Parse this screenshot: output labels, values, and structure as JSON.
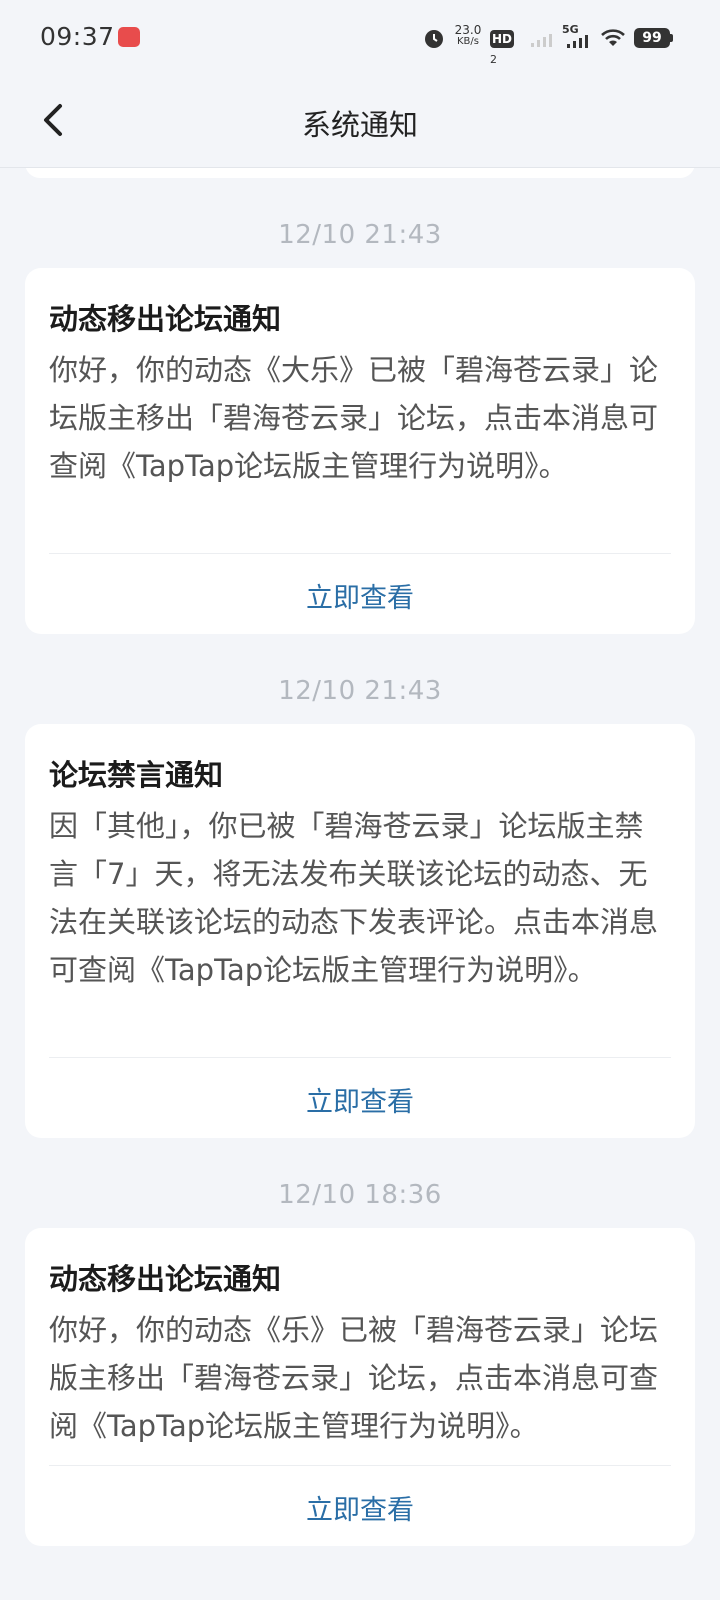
{
  "status_bar": {
    "time": "09:37",
    "net_speed_value": "23.0",
    "net_speed_unit": "KB/s",
    "hd_label": "HD",
    "hd_sub": "2",
    "network": "5G",
    "battery": "99",
    "icons": [
      "app-notification-icon",
      "alarm-icon",
      "hd-icon",
      "signal-weak-icon",
      "signal-5g-icon",
      "wifi-icon",
      "battery-icon"
    ]
  },
  "nav": {
    "back_icon": "chevron-left-icon",
    "title": "系统通知"
  },
  "notifications": [
    {
      "timestamp": "12/10  21:43",
      "title": "动态移出论坛通知",
      "body": "你好，你的动态《大乐》已被「碧海苍云录」论坛版主移出「碧海苍云录」论坛，点击本消息可查阅《TapTap论坛版主管理行为说明》。",
      "action": "立即查看"
    },
    {
      "timestamp": "12/10  21:43",
      "title": "论坛禁言通知",
      "body": "因「其他」，你已被「碧海苍云录」论坛版主禁言「7」天，将无法发布关联该论坛的动态、无法在关联该论坛的动态下发表评论。点击本消息可查阅《TapTap论坛版主管理行为说明》。",
      "action": "立即查看"
    },
    {
      "timestamp": "12/10  18:36",
      "title": "动态移出论坛通知",
      "body": "你好，你的动态《乐》已被「碧海苍云录」论坛版主移出「碧海苍云录」论坛，点击本消息可查阅《TapTap论坛版主管理行为说明》。",
      "action": "立即查看"
    }
  ],
  "colors": {
    "page_background": "#f3f5f9",
    "card_background": "#ffffff",
    "action_link": "#2a6ea6",
    "timestamp": "#b3b8bf"
  }
}
